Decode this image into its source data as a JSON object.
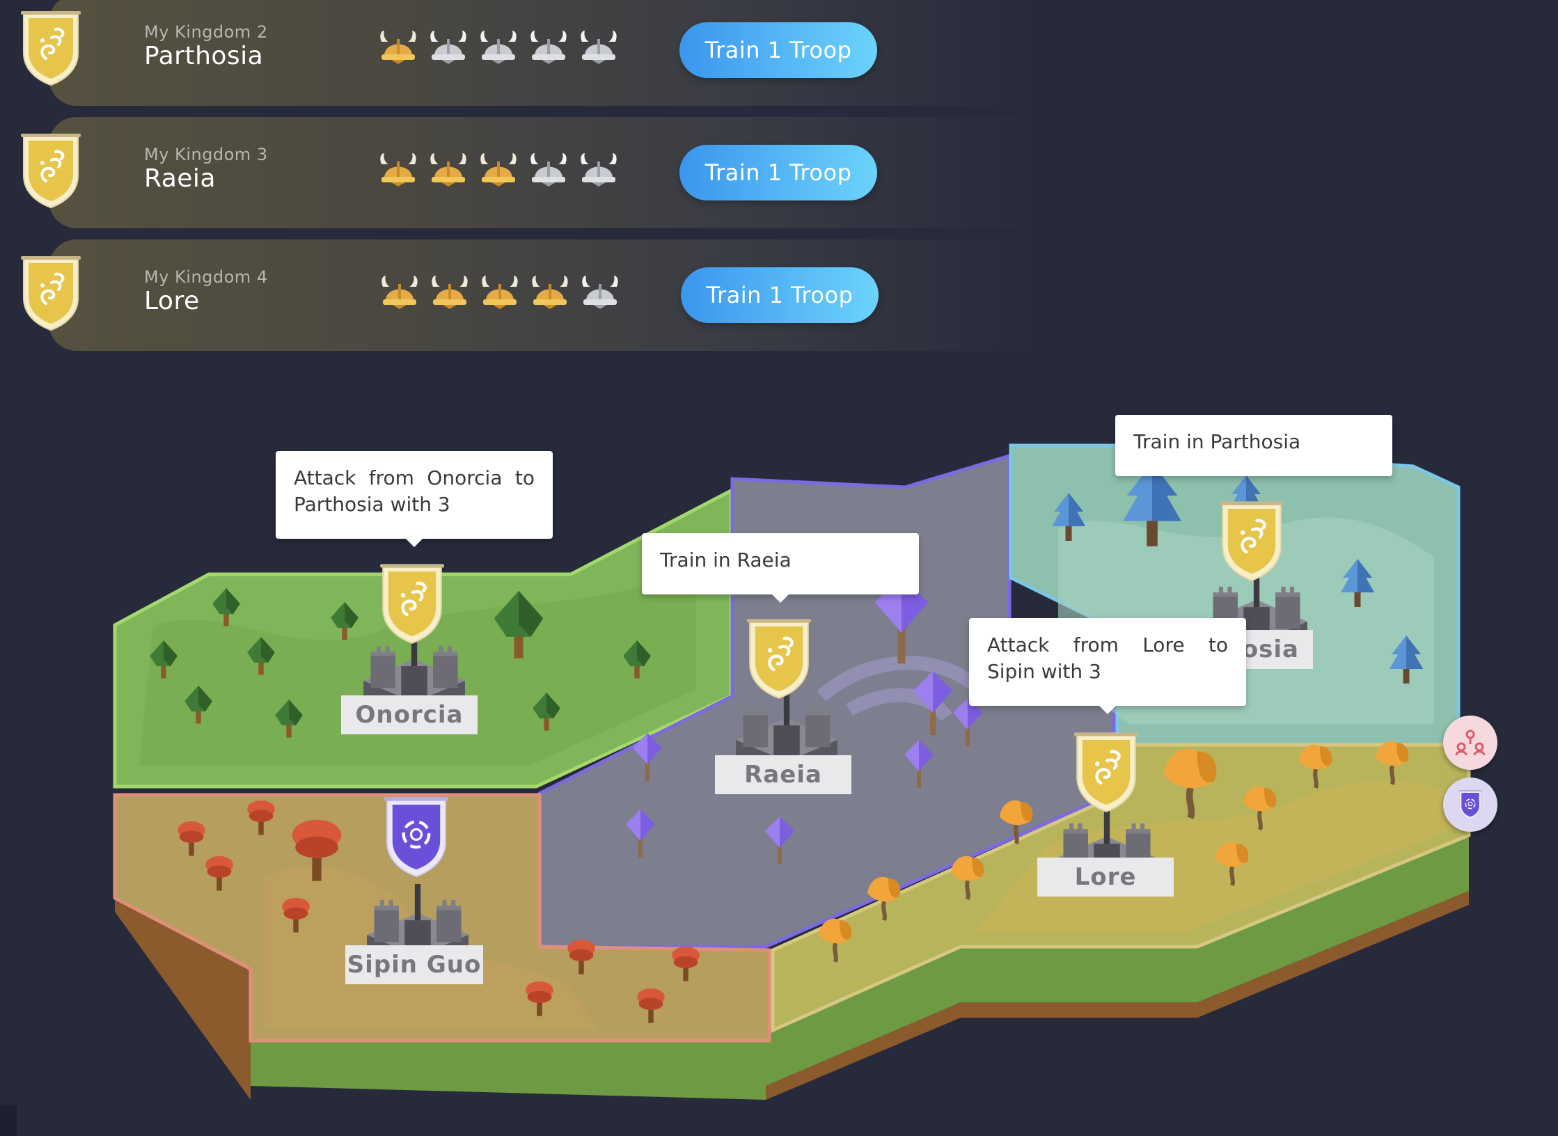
{
  "kingdoms": [
    {
      "sub": "My Kingdom 2",
      "name": "Parthosia",
      "troops": 1,
      "max_troops": 5,
      "button": "Train 1 Troop"
    },
    {
      "sub": "My Kingdom 3",
      "name": "Raeia",
      "troops": 3,
      "max_troops": 5,
      "button": "Train 1 Troop"
    },
    {
      "sub": "My Kingdom 4",
      "name": "Lore",
      "troops": 4,
      "max_troops": 5,
      "button": "Train 1 Troop"
    }
  ],
  "map": {
    "regions": [
      {
        "name": "Onorcia",
        "biome": "forest",
        "color": "#7fb65a",
        "emblem": "gold-shield"
      },
      {
        "name": "Raeia",
        "biome": "crystal",
        "color": "#7d7f8f",
        "emblem": "gold-shield"
      },
      {
        "name": "Parthosia",
        "biome": "ice",
        "color": "#8ec0ae",
        "emblem": "gold-shield",
        "label_visible": "hosia"
      },
      {
        "name": "Sipin Guo",
        "biome": "autumn",
        "color": "#b59e5e",
        "emblem": "purple-shield"
      },
      {
        "name": "Lore",
        "biome": "golden",
        "color": "#b7b45c",
        "emblem": "gold-shield"
      }
    ],
    "tooltips": {
      "onorcia": "Attack from Onorcia to Parthosia with 3",
      "raeia": "Train in Raeia",
      "parthosia": "Train in Parthosia",
      "lore": "Attack from Lore to Sipin with 3"
    }
  },
  "side_buttons": [
    {
      "icon": "alliance-icon",
      "color": "#f6d9df"
    },
    {
      "icon": "purple-shield-icon",
      "color": "#dcd8f2"
    }
  ],
  "colors": {
    "background": "#262a3a",
    "button_gradient_start": "#3b96ee",
    "button_gradient_end": "#6cd3fb",
    "gold": "#e7c54a",
    "purple": "#6a4fd8"
  }
}
